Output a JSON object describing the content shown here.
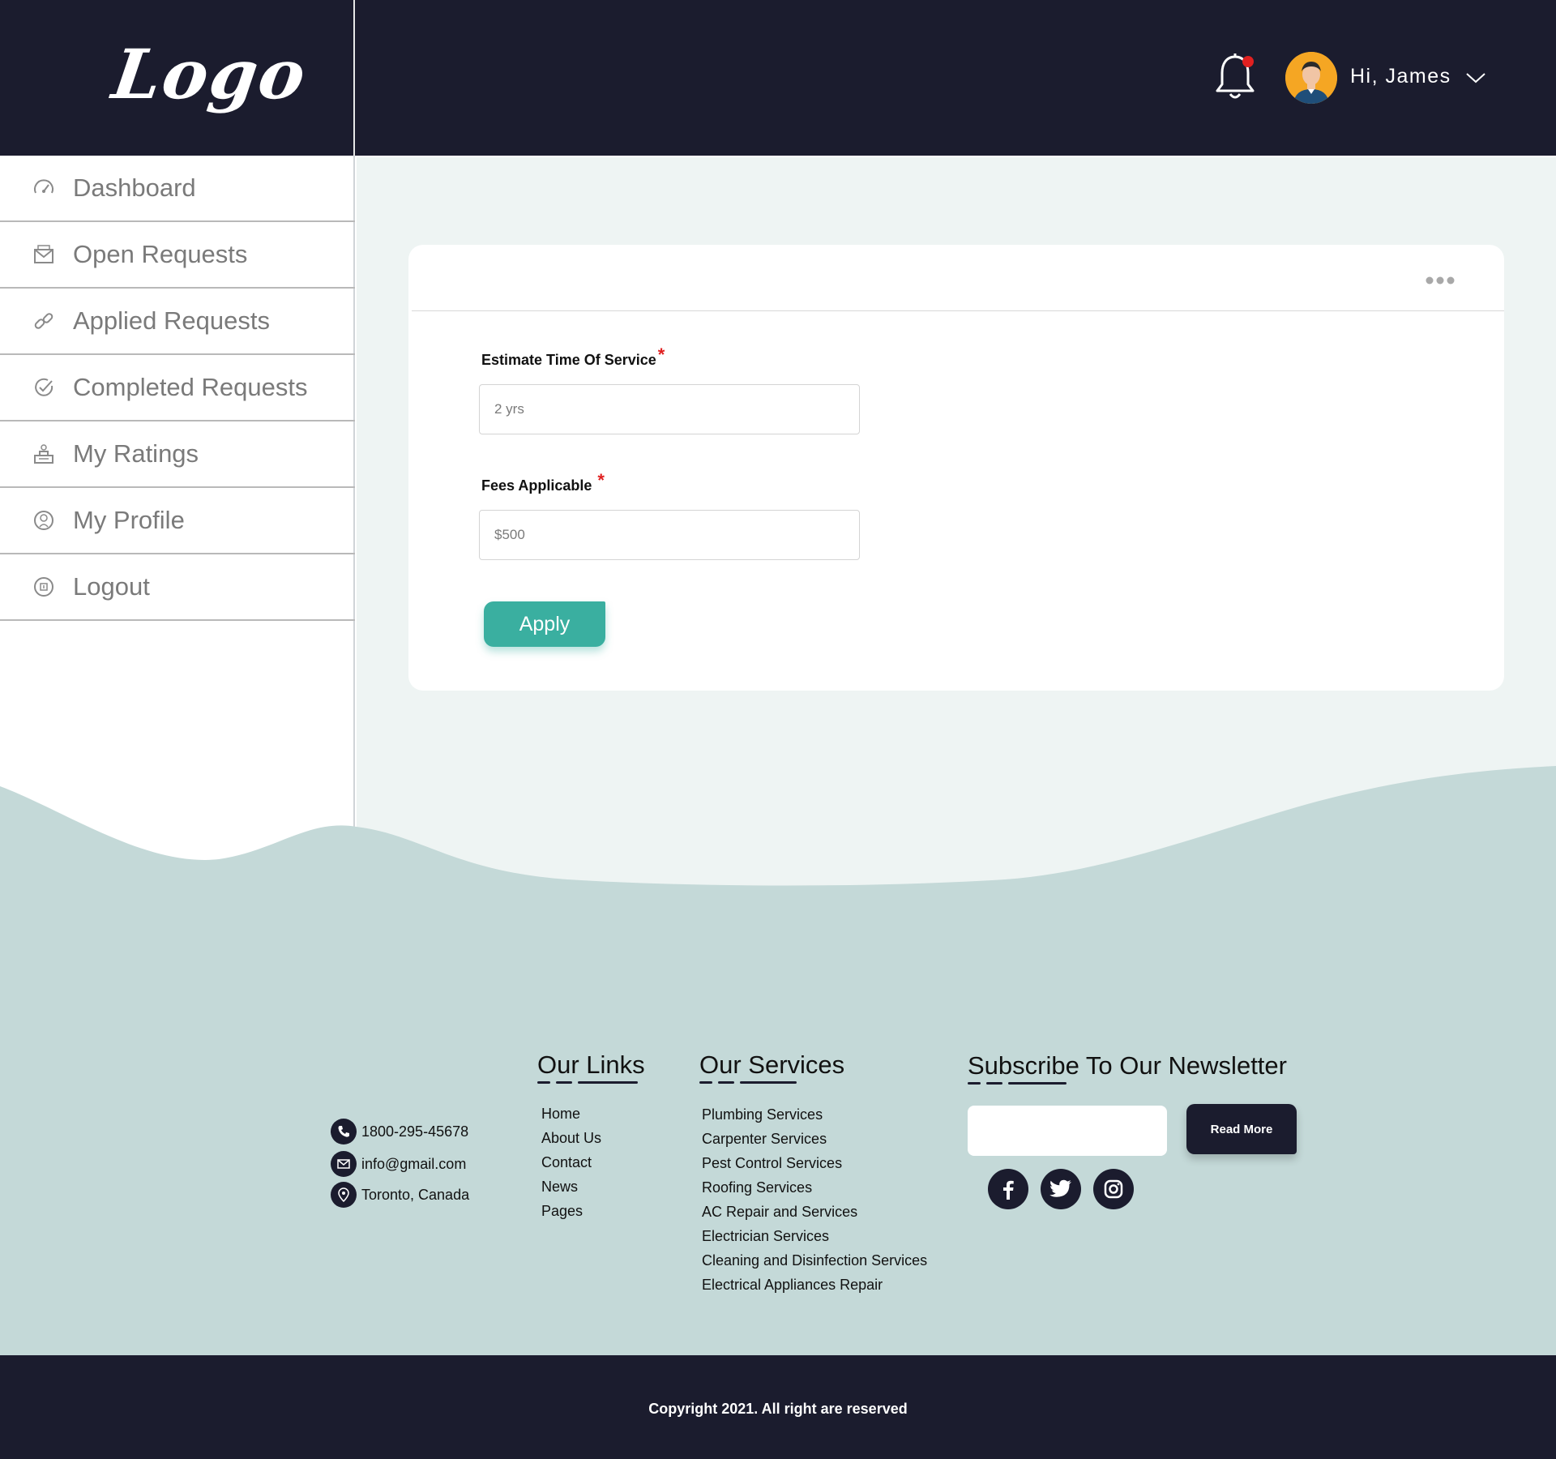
{
  "header": {
    "logo": "Logo",
    "greeting": "Hi, James"
  },
  "sidebar": {
    "items": [
      {
        "label": "Dashboard",
        "icon": "dashboard-icon"
      },
      {
        "label": "Open Requests",
        "icon": "envelope-icon"
      },
      {
        "label": "Applied Requests",
        "icon": "link-icon"
      },
      {
        "label": "Completed Requests",
        "icon": "check-circle-icon"
      },
      {
        "label": "My Ratings",
        "icon": "podium-icon"
      },
      {
        "label": "My Profile",
        "icon": "user-circle-icon"
      },
      {
        "label": "Logout",
        "icon": "logout-icon"
      }
    ]
  },
  "form": {
    "estimate_label": "Estimate Time Of Service",
    "estimate_value": "2 yrs",
    "fees_label": "Fees Applicable ",
    "fees_value": "$500",
    "required_mark": "*",
    "apply_label": "Apply"
  },
  "footer": {
    "contact": {
      "phone": "1800-295-45678",
      "email": "info@gmail.com",
      "location": "Toronto, Canada"
    },
    "links_heading": "Our Links",
    "links": [
      "Home",
      "About Us",
      "Contact",
      "News",
      "Pages"
    ],
    "services_heading": "Our Services",
    "services": [
      "Plumbing Services",
      "Carpenter Services",
      "Pest Control Services",
      "Roofing Services",
      "AC Repair and Services",
      "Electrician Services",
      "Cleaning and Disinfection Services",
      "Electrical Appliances Repair"
    ],
    "newsletter_heading": "Subscribe To Our Newsletter",
    "newsletter_button": "Read More",
    "social": [
      "facebook-icon",
      "twitter-icon",
      "instagram-icon"
    ],
    "copyright": "Copyright 2021. All right are reserved"
  },
  "colors": {
    "navy": "#1b1c2e",
    "accent": "#3aafa0",
    "footer_bg": "#c4d9d8",
    "main_bg": "#eef4f3",
    "notification_dot": "#e02020"
  }
}
